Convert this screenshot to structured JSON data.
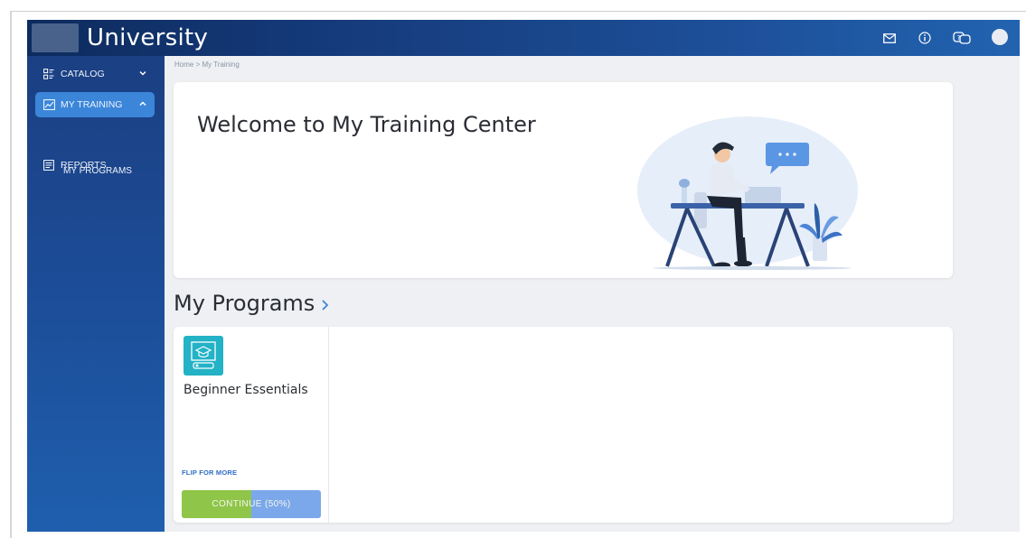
{
  "header": {
    "brand": "University",
    "icons": [
      "mail-icon",
      "info-icon",
      "help-chat-icon",
      "avatar"
    ]
  },
  "sidebar": {
    "items": [
      {
        "label": "CATALOG",
        "icon": "catalog-icon",
        "expanded": false
      },
      {
        "label": "MY TRAINING",
        "icon": "chart-icon",
        "expanded": true,
        "active": true
      },
      {
        "label": "MY PROGRAMS",
        "sub": true
      },
      {
        "label": "REPORTS",
        "icon": "reports-icon"
      }
    ]
  },
  "breadcrumb": "Home > My Training",
  "welcome": {
    "title": "Welcome to My Training Center"
  },
  "programs": {
    "title": "My Programs",
    "cards": [
      {
        "name": "Beginner Essentials",
        "flip_label": "FLIP FOR MORE",
        "button_label": "CONTINUE (50%)",
        "progress": 0.5
      }
    ]
  },
  "colors": {
    "accent": "#3b86d9",
    "progress_fill": "#8fc548",
    "progress_track": "#7ba8ea",
    "program_icon_bg": "#23b2c6"
  }
}
